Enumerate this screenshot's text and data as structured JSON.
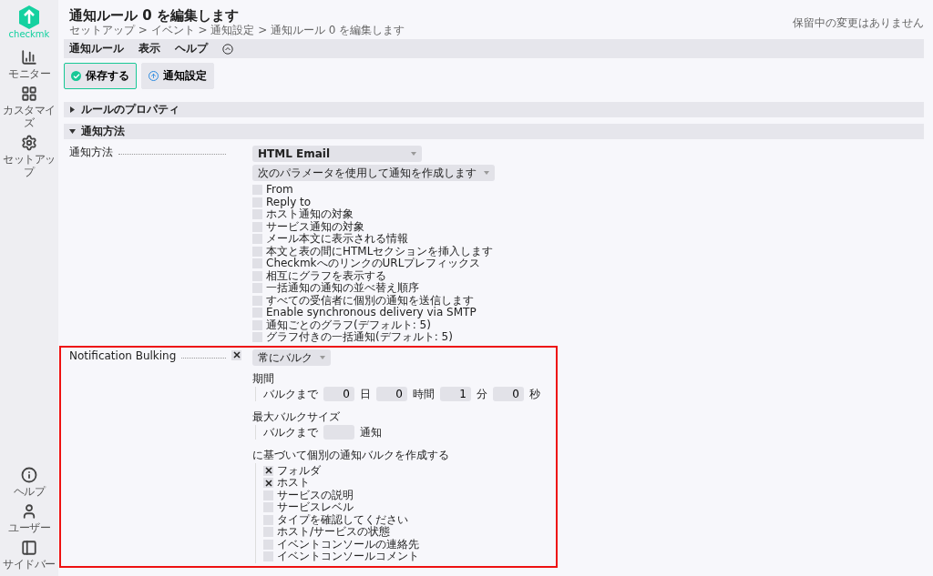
{
  "logo": {
    "text": "checkmk"
  },
  "sidebar": {
    "top": [
      {
        "label": "モニター",
        "kind": "chart"
      },
      {
        "label": "カスタマイズ",
        "kind": "grid"
      },
      {
        "label": "セットアップ",
        "kind": "gear"
      }
    ],
    "bottom": [
      {
        "label": "ヘルプ",
        "kind": "info"
      },
      {
        "label": "ユーザー",
        "kind": "user"
      },
      {
        "label": "サイドバー",
        "kind": "panel"
      }
    ]
  },
  "header": {
    "title": "通知ルール 0 を編集します",
    "breadcrumb": "セットアップ > イベント > 通知設定 > 通知ルール 0 を編集します",
    "pending": "保留中の変更はありません"
  },
  "menu": [
    "通知ルール",
    "表示",
    "ヘルプ"
  ],
  "buttons": [
    {
      "label": "保存する",
      "kind": "save"
    },
    {
      "label": "通知設定",
      "kind": "up"
    }
  ],
  "sections": [
    {
      "title": "ルールのプロパティ",
      "expanded": false
    },
    {
      "title": "通知方法",
      "expanded": true
    }
  ],
  "method": {
    "label": "通知方法",
    "plugin": "HTML Email",
    "params_select": "次のパラメータを使用して通知を作成します",
    "params": [
      {
        "label": "From",
        "checked": false
      },
      {
        "label": "Reply to",
        "checked": false
      },
      {
        "label": "ホスト通知の対象",
        "checked": false
      },
      {
        "label": "サービス通知の対象",
        "checked": false
      },
      {
        "label": "メール本文に表示される情報",
        "checked": false
      },
      {
        "label": "本文と表の間にHTMLセクションを挿入します",
        "checked": false
      },
      {
        "label": "CheckmkへのリンクのURLプレフィックス",
        "checked": false
      },
      {
        "label": "相互にグラフを表示する",
        "checked": false
      },
      {
        "label": "一括通知の通知の並べ替え順序",
        "checked": false
      },
      {
        "label": "すべての受信者に個別の通知を送信します",
        "checked": false
      },
      {
        "label": "Enable synchronous delivery via SMTP",
        "checked": false
      },
      {
        "label": "通知ごとのグラフ(デフォルト: 5)",
        "checked": false
      },
      {
        "label": "グラフ付きの一括通知(デフォルト: 5)",
        "checked": false
      }
    ]
  },
  "bulking": {
    "label": "Notification Bulking",
    "enabled": true,
    "highlighted": true,
    "mode": "常にバルク",
    "period": {
      "title": "期間",
      "prefix": "バルクまで",
      "fields": [
        {
          "value": "0",
          "unit": "日"
        },
        {
          "value": "0",
          "unit": "時間"
        },
        {
          "value": "1",
          "unit": "分"
        },
        {
          "value": "0",
          "unit": "秒"
        }
      ]
    },
    "max": {
      "title": "最大バルクサイズ",
      "prefix": "バルクまで",
      "unit": "通知"
    },
    "group_by": {
      "title": "に基づいて個別の通知バルクを作成する",
      "options": [
        {
          "label": "フォルダ",
          "checked": true
        },
        {
          "label": "ホスト",
          "checked": true
        },
        {
          "label": "サービスの説明",
          "checked": false
        },
        {
          "label": "サービスレベル",
          "checked": false
        },
        {
          "label": "タイプを確認してください",
          "checked": false
        },
        {
          "label": "ホスト/サービスの状態",
          "checked": false
        },
        {
          "label": "イベントコンソールの連絡先",
          "checked": false
        },
        {
          "label": "イベントコンソールコメント",
          "checked": false
        }
      ]
    }
  }
}
